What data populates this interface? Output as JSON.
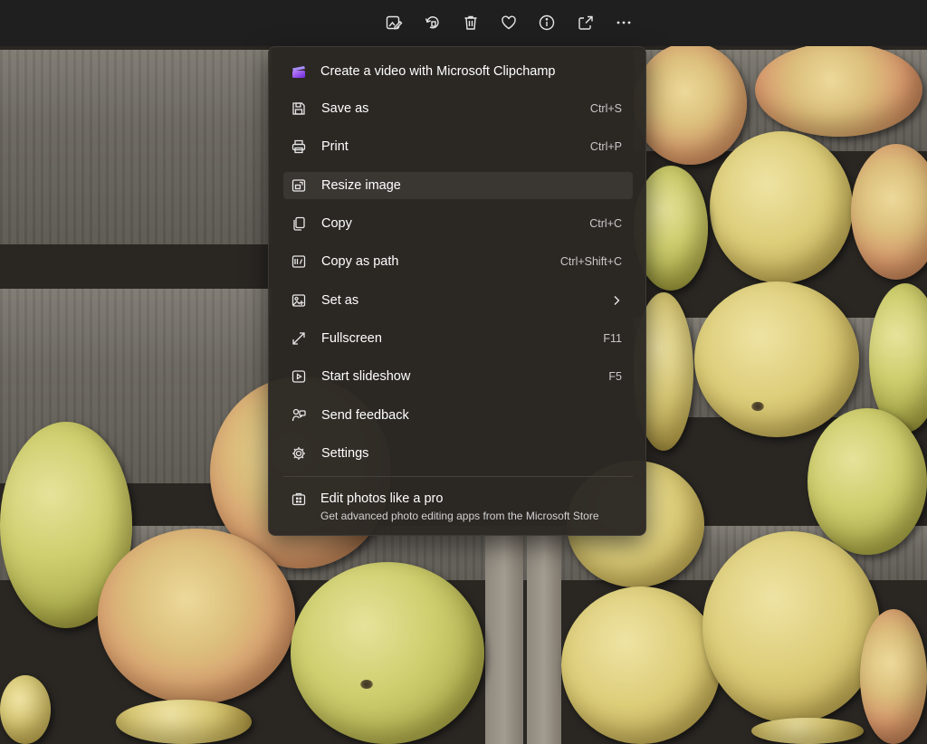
{
  "toolbar": {
    "icons": [
      "edit-image-icon",
      "rotate-icon",
      "delete-icon",
      "favorite-icon",
      "info-icon",
      "share-icon",
      "more-icon"
    ]
  },
  "menu": {
    "items": [
      {
        "label": "Create a video with Microsoft Clipchamp",
        "shortcut": "",
        "icon": "clipchamp-icon"
      },
      {
        "label": "Save as",
        "shortcut": "Ctrl+S",
        "icon": "save-icon"
      },
      {
        "label": "Print",
        "shortcut": "Ctrl+P",
        "icon": "print-icon"
      },
      {
        "label": "Resize image",
        "shortcut": "",
        "icon": "resize-icon"
      },
      {
        "label": "Copy",
        "shortcut": "Ctrl+C",
        "icon": "copy-icon"
      },
      {
        "label": "Copy as path",
        "shortcut": "Ctrl+Shift+C",
        "icon": "copy-path-icon"
      },
      {
        "label": "Set as",
        "shortcut": "",
        "icon": "set-as-icon"
      },
      {
        "label": "Fullscreen",
        "shortcut": "F11",
        "icon": "fullscreen-icon"
      },
      {
        "label": "Start slideshow",
        "shortcut": "F5",
        "icon": "slideshow-icon"
      },
      {
        "label": "Send feedback",
        "shortcut": "",
        "icon": "feedback-icon"
      },
      {
        "label": "Settings",
        "shortcut": "",
        "icon": "settings-icon"
      }
    ],
    "promo": {
      "title": "Edit photos like a pro",
      "subtitle": "Get advanced photo editing apps from the Microsoft Store",
      "icon": "store-icon"
    }
  },
  "colors": {
    "toolbar_bg": "#1f1f1f",
    "menu_bg": "#2b2824",
    "hover_bg": "#3a3733",
    "clipchamp_accent": "#8b5cf6"
  }
}
